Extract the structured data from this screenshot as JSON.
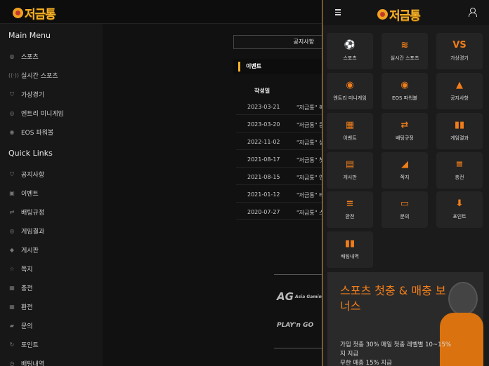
{
  "brand": {
    "name": "저금통"
  },
  "sidebar": {
    "main_menu_title": "Main Menu",
    "main_items": [
      {
        "label": "스포츠",
        "icon": "soccer-ball-icon"
      },
      {
        "label": "실시간 스포츠",
        "icon": "live-signal-icon"
      },
      {
        "label": "가상경기",
        "icon": "shield-icon"
      },
      {
        "label": "엔트리 미니게임",
        "icon": "target-icon"
      },
      {
        "label": "EOS 파워볼",
        "icon": "ball-icon"
      }
    ],
    "quick_links_title": "Quick Links",
    "quick_items": [
      {
        "label": "공지사항",
        "icon": "notice-icon"
      },
      {
        "label": "이벤트",
        "icon": "calendar-icon"
      },
      {
        "label": "배팅규정",
        "icon": "rules-icon"
      },
      {
        "label": "게임결과",
        "icon": "result-icon"
      },
      {
        "label": "게시판",
        "icon": "board-icon"
      },
      {
        "label": "쪽지",
        "icon": "star-icon"
      },
      {
        "label": "충전",
        "icon": "deposit-icon"
      },
      {
        "label": "환전",
        "icon": "withdraw-icon"
      },
      {
        "label": "문의",
        "icon": "chat-icon"
      },
      {
        "label": "포인트",
        "icon": "refresh-icon"
      },
      {
        "label": "배팅내역",
        "icon": "history-icon"
      }
    ]
  },
  "main": {
    "notice_tab": "공지사항",
    "event_tab": "이벤트",
    "date_header": "작성일",
    "rows": [
      {
        "date": "2023-03-21",
        "title": "\"저금통\" 복"
      },
      {
        "date": "2023-03-20",
        "title": "\"저금통\" 등"
      },
      {
        "date": "2022-11-02",
        "title": "\"저금통\" 생"
      },
      {
        "date": "2021-08-17",
        "title": "\"저금통\" 첫"
      },
      {
        "date": "2021-08-15",
        "title": "\"저금통\" 연"
      },
      {
        "date": "2021-01-12",
        "title": "\"저금통\" 티"
      },
      {
        "date": "2020-07-27",
        "title": "\"저금통\" 스"
      }
    ],
    "providers": {
      "ag_logo": "AG",
      "ag_sub": "Asia Gaming",
      "playngo": "PLAY'n GO"
    }
  },
  "drawer": {
    "tiles": [
      {
        "label": "스포츠",
        "icon": "soccer-ball-icon",
        "glyph": "⚽"
      },
      {
        "label": "실시간 스포츠",
        "icon": "wifi-icon",
        "glyph": "≋"
      },
      {
        "label": "가상경기",
        "icon": "vs-icon",
        "glyph": "VS"
      },
      {
        "label": "엔트리 미니게임",
        "icon": "basketball-icon",
        "glyph": "◉"
      },
      {
        "label": "EOS 파워볼",
        "icon": "basketball-icon",
        "glyph": "◉"
      },
      {
        "label": "공지사항",
        "icon": "bell-icon",
        "glyph": "▲"
      },
      {
        "label": "이벤트",
        "icon": "calendar-icon",
        "glyph": "▦"
      },
      {
        "label": "배팅규정",
        "icon": "swap-icon",
        "glyph": "⇄"
      },
      {
        "label": "게임결과",
        "icon": "bar-chart-icon",
        "glyph": "▮▮"
      },
      {
        "label": "게시판",
        "icon": "clipboard-icon",
        "glyph": "▤"
      },
      {
        "label": "쪽지",
        "icon": "megaphone-icon",
        "glyph": "◢"
      },
      {
        "label": "충전",
        "icon": "database-icon",
        "glyph": "≡"
      },
      {
        "label": "환전",
        "icon": "database-icon",
        "glyph": "≡"
      },
      {
        "label": "문의",
        "icon": "chat-icon",
        "glyph": "▭"
      },
      {
        "label": "포인트",
        "icon": "download-arrow-icon",
        "glyph": "⬇"
      },
      {
        "label": "배팅내역",
        "icon": "bar-chart-icon",
        "glyph": "▮▮"
      }
    ],
    "banner": {
      "line1": "스포츠 첫충 & 매충 보",
      "line2": "너스",
      "desc1": "가입 첫충 30% 매일 첫충 레벨별 10~15%",
      "desc2": "지 지급",
      "desc3": "무한 매충 15% 지급"
    }
  },
  "colors": {
    "accent": "#f4b128",
    "tile_icon": "#ef7d1a",
    "drawer_border": "#d9a24a"
  }
}
